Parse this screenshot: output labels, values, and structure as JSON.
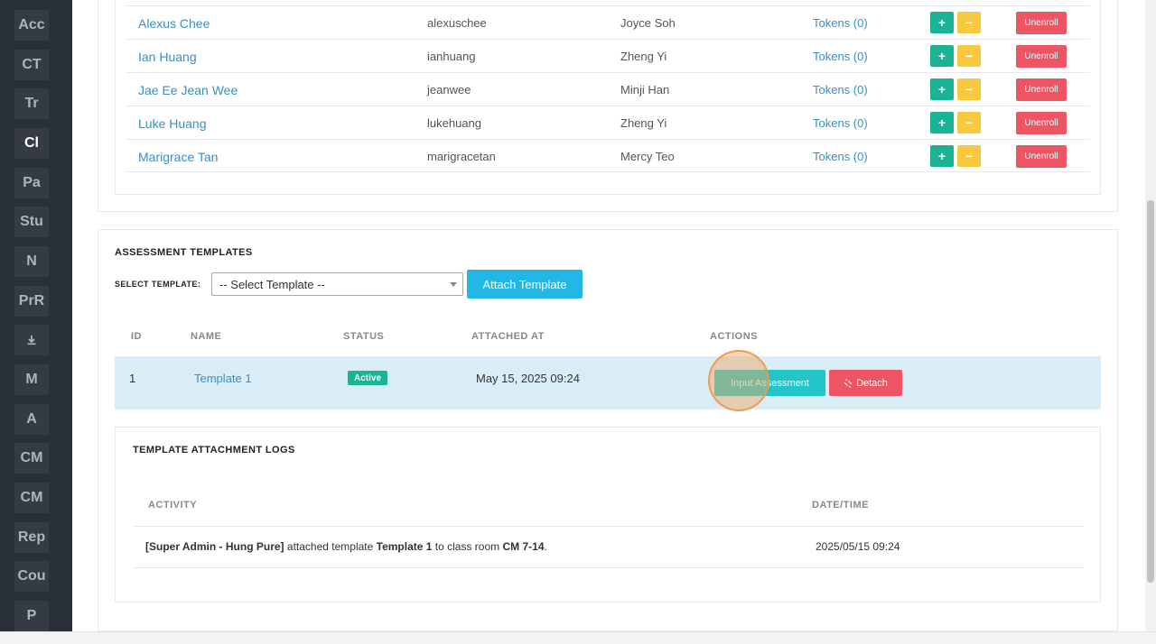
{
  "sidebar": {
    "items": [
      {
        "label": "Acc",
        "active": false
      },
      {
        "label": "CT",
        "active": false
      },
      {
        "label": "Tr",
        "active": false
      },
      {
        "label": "Cl",
        "active": true
      },
      {
        "label": "Pa",
        "active": false
      },
      {
        "label": "Stu",
        "active": false
      },
      {
        "label": "N",
        "active": false
      },
      {
        "label": "PrR",
        "active": false
      },
      {
        "label": "",
        "icon": "download-icon",
        "active": false
      },
      {
        "label": "M",
        "active": false
      },
      {
        "label": "A",
        "active": false
      },
      {
        "label": "CM",
        "active": false
      },
      {
        "label": "CM",
        "active": false
      },
      {
        "label": "Rep",
        "active": false
      },
      {
        "label": "Cou",
        "active": false
      },
      {
        "label": "P",
        "active": false
      }
    ]
  },
  "students": {
    "rows": [
      {
        "name": "Alexus Chee",
        "username": "alexuschee",
        "teacher": "Joyce Soh",
        "tokens": "Tokens (0)",
        "plus": "+",
        "minus": "−",
        "unenroll": "Unenroll"
      },
      {
        "name": "Ian Huang",
        "username": "ianhuang",
        "teacher": "Zheng Yi",
        "tokens": "Tokens (0)",
        "plus": "+",
        "minus": "−",
        "unenroll": "Unenroll"
      },
      {
        "name": "Jae Ee Jean Wee",
        "username": "jeanwee",
        "teacher": "Minji Han",
        "tokens": "Tokens (0)",
        "plus": "+",
        "minus": "−",
        "unenroll": "Unenroll"
      },
      {
        "name": "Luke Huang",
        "username": "lukehuang",
        "teacher": "Zheng Yi",
        "tokens": "Tokens (0)",
        "plus": "+",
        "minus": "−",
        "unenroll": "Unenroll"
      },
      {
        "name": "Marigrace Tan",
        "username": "marigracetan",
        "teacher": "Mercy Teo",
        "tokens": "Tokens (0)",
        "plus": "+",
        "minus": "−",
        "unenroll": "Unenroll"
      }
    ]
  },
  "assessment": {
    "title": "ASSESSMENT TEMPLATES",
    "select_label": "SELECT TEMPLATE:",
    "select_value": "-- Select Template --",
    "attach_button": "Attach Template",
    "columns": {
      "id": "ID",
      "name": "NAME",
      "status": "STATUS",
      "attached_at": "ATTACHED AT",
      "actions": "ACTIONS"
    },
    "row": {
      "id": "1",
      "name": "Template 1",
      "status": "Active",
      "attached_at": "May 15, 2025 09:24",
      "input_button": "Input Assessment",
      "detach_button": "Detach"
    }
  },
  "logs": {
    "title": "TEMPLATE ATTACHMENT LOGS",
    "columns": {
      "activity": "ACTIVITY",
      "datetime": "DATE/TIME"
    },
    "entry": {
      "actor": "[Super Admin - Hung Pure]",
      "verb": " attached template ",
      "template": "Template 1",
      "connector": " to class room ",
      "room": "CM 7-14",
      "end": ".",
      "datetime": "2025/05/15 09:24"
    }
  },
  "colors": {
    "sidebar_bg": "#2a3038",
    "link": "#3a8fc1",
    "plus": "#1ab394",
    "minus": "#f8c93f",
    "danger": "#ed5565",
    "info": "#23b7e5",
    "highlight_row": "#d9edf7"
  }
}
